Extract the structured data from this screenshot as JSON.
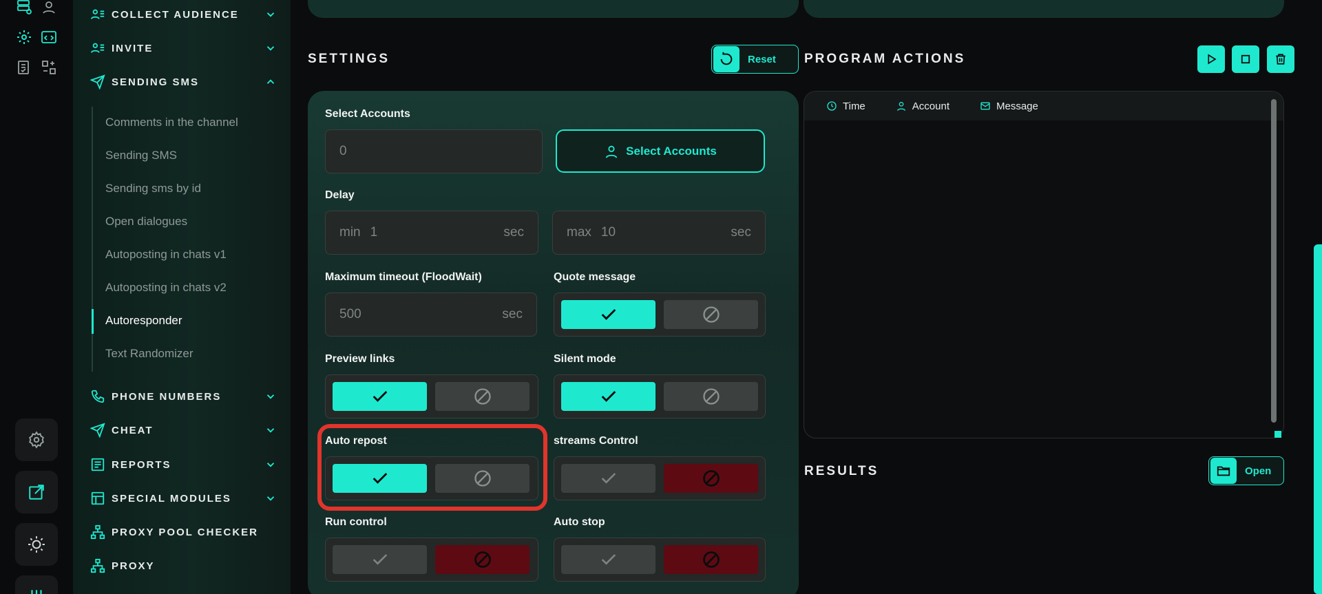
{
  "sidebar": {
    "sections": [
      {
        "label": "COLLECT AUDIENCE"
      },
      {
        "label": "INVITE"
      },
      {
        "label": "SENDING SMS"
      },
      {
        "label": "PHONE NUMBERS"
      },
      {
        "label": "CHEAT"
      },
      {
        "label": "REPORTS"
      },
      {
        "label": "SPECIAL MODULES"
      },
      {
        "label": "PROXY POOL CHECKER"
      },
      {
        "label": "PROXY"
      }
    ],
    "sending_sms_items": [
      {
        "label": "Comments in the channel"
      },
      {
        "label": "Sending SMS"
      },
      {
        "label": "Sending sms by id"
      },
      {
        "label": "Open dialogues"
      },
      {
        "label": "Autoposting in chats v1"
      },
      {
        "label": "Autoposting in chats v2"
      },
      {
        "label": "Autoresponder",
        "active": true
      },
      {
        "label": "Text Randomizer"
      }
    ]
  },
  "settings": {
    "title": "SETTINGS",
    "reset_label": "Reset",
    "select_accounts_label": "Select Accounts",
    "accounts_value": "0",
    "select_accounts_button": "Select Accounts",
    "delay_label": "Delay",
    "delay_min_prefix": "min",
    "delay_min_value": "1",
    "delay_max_prefix": "max",
    "delay_max_value": "10",
    "unit_sec": "sec",
    "max_timeout_label": "Maximum timeout (FloodWait)",
    "max_timeout_value": "500",
    "quote_message_label": "Quote message",
    "quote_message_state": "on",
    "preview_links_label": "Preview links",
    "preview_links_state": "on",
    "silent_mode_label": "Silent mode",
    "silent_mode_state": "on",
    "auto_repost_label": "Auto repost",
    "auto_repost_state": "on",
    "streams_control_label": "streams Control",
    "streams_control_state": "off",
    "run_control_label": "Run control",
    "run_control_state": "off",
    "auto_stop_label": "Auto stop",
    "auto_stop_state": "off"
  },
  "program_actions": {
    "title": "PROGRAM ACTIONS",
    "columns": [
      "Time",
      "Account",
      "Message"
    ]
  },
  "results": {
    "title": "RESULTS",
    "open_label": "Open"
  },
  "colors": {
    "accent": "#1ee9cf",
    "off_active": "#5e0a13",
    "highlight": "#e0342c"
  }
}
